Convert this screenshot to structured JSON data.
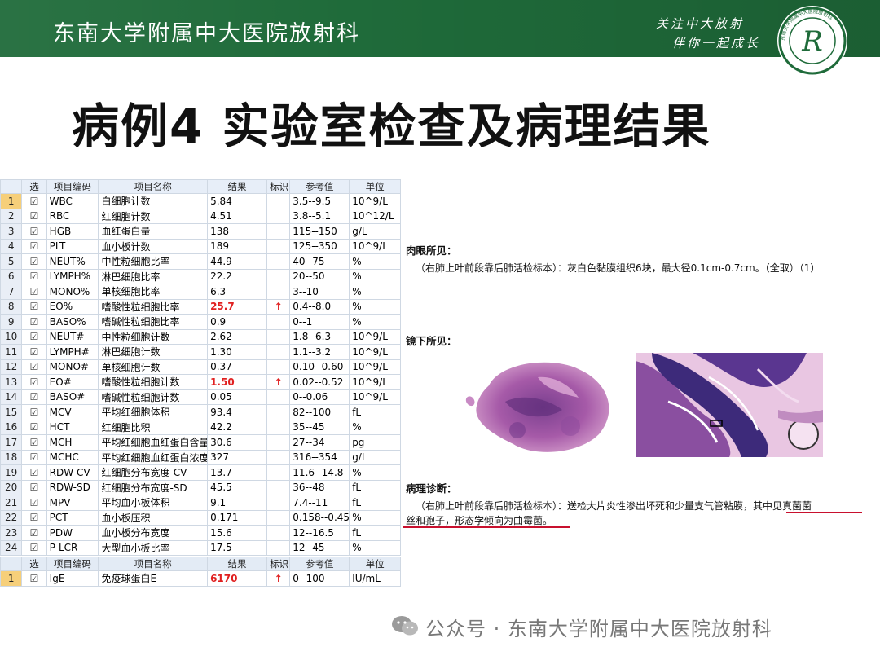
{
  "header": {
    "title": "东南大学附属中大医院放射科",
    "slogan_line1": "关注中大放射",
    "slogan_line2": "伴你一起成长",
    "logo_letter": "R",
    "logo_ring_text": "东南大学附属中大医院放射科"
  },
  "slide_title": "病例4  实验室检查及病理结果",
  "lab_table": {
    "columns": [
      "选",
      "项目编码",
      "项目名称",
      "结果",
      "标识",
      "参考值",
      "单位"
    ],
    "rows": [
      {
        "n": "1",
        "code": "WBC",
        "name": "白细胞计数",
        "result": "5.84",
        "flag": "",
        "ref": "3.5--9.5",
        "unit": "10^9/L",
        "high": false
      },
      {
        "n": "2",
        "code": "RBC",
        "name": "红细胞计数",
        "result": "4.51",
        "flag": "",
        "ref": "3.8--5.1",
        "unit": "10^12/L",
        "high": false
      },
      {
        "n": "3",
        "code": "HGB",
        "name": "血红蛋白量",
        "result": "138",
        "flag": "",
        "ref": "115--150",
        "unit": "g/L",
        "high": false
      },
      {
        "n": "4",
        "code": "PLT",
        "name": "血小板计数",
        "result": "189",
        "flag": "",
        "ref": "125--350",
        "unit": "10^9/L",
        "high": false
      },
      {
        "n": "5",
        "code": "NEUT%",
        "name": "中性粒细胞比率",
        "result": "44.9",
        "flag": "",
        "ref": "40--75",
        "unit": "%",
        "high": false
      },
      {
        "n": "6",
        "code": "LYMPH%",
        "name": "淋巴细胞比率",
        "result": "22.2",
        "flag": "",
        "ref": "20--50",
        "unit": "%",
        "high": false
      },
      {
        "n": "7",
        "code": "MONO%",
        "name": "单核细胞比率",
        "result": "6.3",
        "flag": "",
        "ref": "3--10",
        "unit": "%",
        "high": false
      },
      {
        "n": "8",
        "code": "EO%",
        "name": "嗜酸性粒细胞比率",
        "result": "25.7",
        "flag": "↑",
        "ref": "0.4--8.0",
        "unit": "%",
        "high": true
      },
      {
        "n": "9",
        "code": "BASO%",
        "name": "嗜碱性粒细胞比率",
        "result": "0.9",
        "flag": "",
        "ref": "0--1",
        "unit": "%",
        "high": false
      },
      {
        "n": "10",
        "code": "NEUT#",
        "name": "中性粒细胞计数",
        "result": "2.62",
        "flag": "",
        "ref": "1.8--6.3",
        "unit": "10^9/L",
        "high": false
      },
      {
        "n": "11",
        "code": "LYMPH#",
        "name": "淋巴细胞计数",
        "result": "1.30",
        "flag": "",
        "ref": "1.1--3.2",
        "unit": "10^9/L",
        "high": false
      },
      {
        "n": "12",
        "code": "MONO#",
        "name": "单核细胞计数",
        "result": "0.37",
        "flag": "",
        "ref": "0.10--0.60",
        "unit": "10^9/L",
        "high": false
      },
      {
        "n": "13",
        "code": "EO#",
        "name": "嗜酸性粒细胞计数",
        "result": "1.50",
        "flag": "↑",
        "ref": "0.02--0.52",
        "unit": "10^9/L",
        "high": true
      },
      {
        "n": "14",
        "code": "BASO#",
        "name": "嗜碱性粒细胞计数",
        "result": "0.05",
        "flag": "",
        "ref": "0--0.06",
        "unit": "10^9/L",
        "high": false
      },
      {
        "n": "15",
        "code": "MCV",
        "name": "平均红细胞体积",
        "result": "93.4",
        "flag": "",
        "ref": "82--100",
        "unit": "fL",
        "high": false
      },
      {
        "n": "16",
        "code": "HCT",
        "name": "红细胞比积",
        "result": "42.2",
        "flag": "",
        "ref": "35--45",
        "unit": "%",
        "high": false
      },
      {
        "n": "17",
        "code": "MCH",
        "name": "平均红细胞血红蛋白含量",
        "result": "30.6",
        "flag": "",
        "ref": "27--34",
        "unit": "pg",
        "high": false
      },
      {
        "n": "18",
        "code": "MCHC",
        "name": "平均红细胞血红蛋白浓度",
        "result": "327",
        "flag": "",
        "ref": "316--354",
        "unit": "g/L",
        "high": false
      },
      {
        "n": "19",
        "code": "RDW-CV",
        "name": "红细胞分布宽度-CV",
        "result": "13.7",
        "flag": "",
        "ref": "11.6--14.8",
        "unit": "%",
        "high": false
      },
      {
        "n": "20",
        "code": "RDW-SD",
        "name": "红细胞分布宽度-SD",
        "result": "45.5",
        "flag": "",
        "ref": "36--48",
        "unit": "fL",
        "high": false
      },
      {
        "n": "21",
        "code": "MPV",
        "name": "平均血小板体积",
        "result": "9.1",
        "flag": "",
        "ref": "7.4--11",
        "unit": "fL",
        "high": false
      },
      {
        "n": "22",
        "code": "PCT",
        "name": "血小板压积",
        "result": "0.171",
        "flag": "",
        "ref": "0.158--0.452",
        "unit": "%",
        "high": false
      },
      {
        "n": "23",
        "code": "PDW",
        "name": "血小板分布宽度",
        "result": "15.6",
        "flag": "",
        "ref": "12--16.5",
        "unit": "fL",
        "high": false
      },
      {
        "n": "24",
        "code": "P-LCR",
        "name": "大型血小板比率",
        "result": "17.5",
        "flag": "",
        "ref": "12--45",
        "unit": "%",
        "high": false
      }
    ]
  },
  "ige_table": {
    "columns": [
      "选",
      "项目编码",
      "项目名称",
      "结果",
      "标识",
      "参考值",
      "单位"
    ],
    "rows": [
      {
        "n": "1",
        "code": "IgE",
        "name": "免疫球蛋白E",
        "result": "6170",
        "flag": "↑",
        "ref": "0--100",
        "unit": "IU/mL",
        "high": true
      }
    ]
  },
  "report": {
    "gross_label": "肉眼所见：",
    "gross_text": "（右肺上叶前段靠后肺活检标本）：灰白色黏膜组织6块，最大径0.1cm-0.7cm。（全取）（1）",
    "micro_label": "镜下所见：",
    "diagnosis_label": "病理诊断：",
    "diagnosis_line1_part1": "（右肺上叶前段靠后肺活检标本）：送检大片炎性渗出坏死和少量支气管粘膜，",
    "diagnosis_line1_part2": "其中见真菌菌",
    "diagnosis_line2": "丝和孢子，形态学倾向为曲霉菌。"
  },
  "footer": {
    "text": "公众号 · 东南大学附属中大医院放射科"
  },
  "colors": {
    "banner_green": "#1f6b3a",
    "high_red": "#e02020",
    "underline_red": "#c8102e"
  }
}
